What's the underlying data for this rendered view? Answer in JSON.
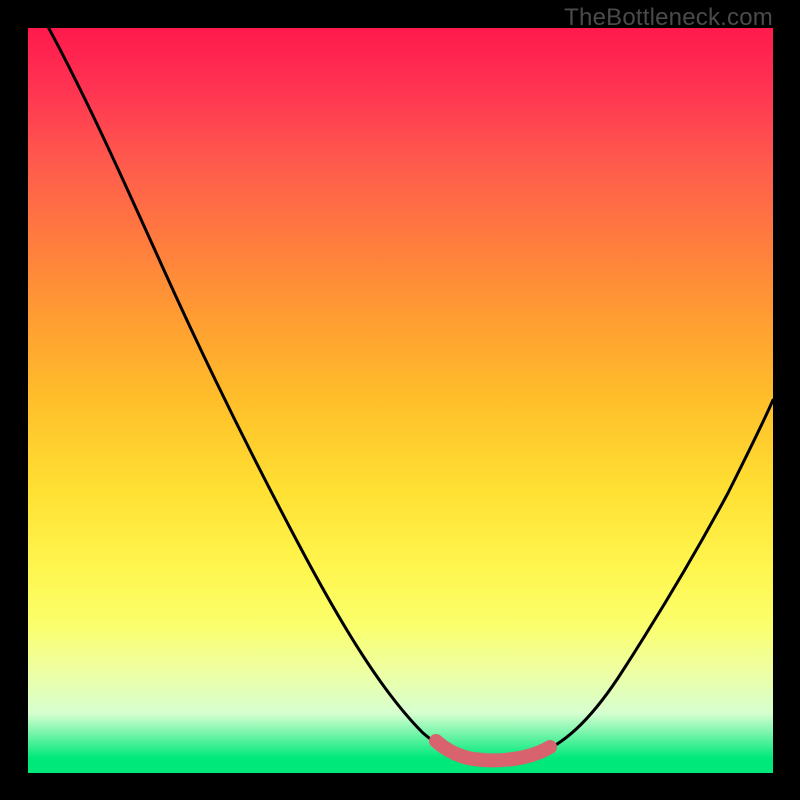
{
  "watermark": "TheBottleneck.com",
  "colors": {
    "frame": "#000000",
    "gradient_top": "#ff1a4d",
    "gradient_bottom": "#00e87a",
    "curve": "#000000",
    "highlight": "#d9626f"
  },
  "chart_data": {
    "type": "line",
    "title": "",
    "xlabel": "",
    "ylabel": "",
    "xlim": [
      0,
      100
    ],
    "ylim": [
      0,
      100
    ],
    "grid": false,
    "series": [
      {
        "name": "bottleneck-curve",
        "x": [
          0,
          6,
          12,
          18,
          24,
          30,
          36,
          42,
          48,
          54,
          56,
          58,
          61,
          64,
          68,
          72,
          76,
          80,
          84,
          88,
          92,
          96,
          100
        ],
        "y": [
          105,
          93,
          80,
          67,
          55,
          43,
          33,
          24,
          16,
          8,
          5,
          3,
          2,
          2,
          2,
          3,
          6,
          10,
          15,
          22,
          30,
          40,
          50
        ]
      },
      {
        "name": "flat-segment-highlight",
        "x": [
          56,
          58,
          60,
          62,
          64,
          66,
          68,
          70
        ],
        "y": [
          5,
          3.5,
          2.5,
          2,
          2,
          2.3,
          2.8,
          3.5
        ]
      }
    ],
    "annotations": []
  }
}
